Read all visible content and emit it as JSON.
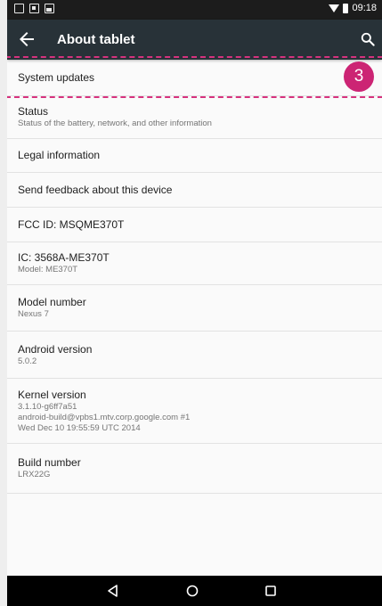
{
  "status_bar": {
    "time": "09:18",
    "left_icons": [
      "screenshot-icon",
      "notification-icon",
      "photo-icon"
    ],
    "right_icons": [
      "wifi-icon",
      "battery-icon"
    ]
  },
  "action_bar": {
    "title": "About tablet",
    "back_icon": "arrow-left-icon",
    "search_icon": "search-icon",
    "background": "#283238"
  },
  "highlight": {
    "badge": "3",
    "color": "#d6327e"
  },
  "items": [
    {
      "title": "System updates",
      "lines": []
    },
    {
      "title": "Status",
      "lines": [
        "Status of the battery, network, and other information"
      ]
    },
    {
      "title": "Legal information",
      "lines": []
    },
    {
      "title": "Send feedback about this device",
      "lines": []
    },
    {
      "title": "FCC ID: MSQME370T",
      "lines": []
    },
    {
      "title": "IC: 3568A-ME370T",
      "lines": [
        "Model: ME370T"
      ]
    },
    {
      "title": "Model number",
      "lines": [
        "Nexus 7"
      ]
    },
    {
      "title": "Android version",
      "lines": [
        "5.0.2"
      ]
    },
    {
      "title": "Kernel version",
      "lines": [
        "3.1.10-g6ff7a51",
        "android-build@vpbs1.mtv.corp.google.com #1",
        "Wed Dec 10 19:55:59 UTC 2014"
      ]
    },
    {
      "title": "Build number",
      "lines": [
        "LRX22G"
      ]
    }
  ],
  "nav_bar": {
    "buttons": [
      "back-triangle-icon",
      "home-circle-icon",
      "recents-square-icon"
    ]
  }
}
